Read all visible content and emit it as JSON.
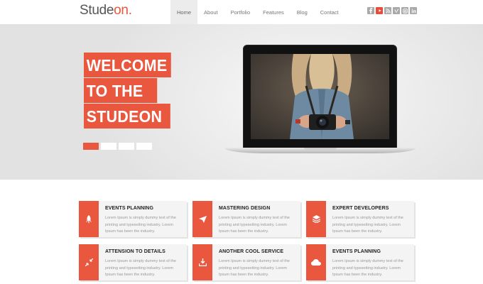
{
  "brand": {
    "logo_main": "Stude",
    "logo_accent": "on",
    "logo_dot": "."
  },
  "nav": {
    "items": [
      {
        "label": "Home",
        "active": true
      },
      {
        "label": "About",
        "active": false
      },
      {
        "label": "Portfolio",
        "active": false
      },
      {
        "label": "Features",
        "active": false
      },
      {
        "label": "Blog",
        "active": false
      },
      {
        "label": "Contact",
        "active": false
      }
    ]
  },
  "social": [
    "facebook-icon",
    "youtube-icon",
    "rss-icon",
    "vimeo-icon",
    "instagram-icon",
    "linkedin-icon"
  ],
  "hero": {
    "headline": [
      "WELCOME",
      "TO THE",
      "STUDEON"
    ],
    "slider_dots": 4,
    "active_dot": 0
  },
  "services": [
    {
      "title": "EVENTS PLANNING",
      "text": "Lorem Ipsum is simply dummy text of the printing and typesetting industry. Lorem Ipsum has been the industry.",
      "icon": "rocket-icon"
    },
    {
      "title": "MASTERING DESIGN",
      "text": "Lorem Ipsum is simply dummy text of the printing and typesetting industry. Lorem Ipsum has been the industry.",
      "icon": "paper-plane-icon"
    },
    {
      "title": "EXPERT DEVELOPERS",
      "text": "Lorem Ipsum is simply dummy text of the printing and typesetting industry. Lorem Ipsum has been the industry.",
      "icon": "layers-icon"
    },
    {
      "title": "ATTENSION TO DETAILS",
      "text": "Lorem Ipsum is simply dummy text of the printing and typesetting industry. Lorem Ipsum has been the industry.",
      "icon": "compress-icon"
    },
    {
      "title": "ANOTHER COOL SERVICE",
      "text": "Lorem Ipsum is simply dummy text of the printing and typesetting industry. Lorem Ipsum has been the industry.",
      "icon": "download-icon"
    },
    {
      "title": "EVENTS PLANNING",
      "text": "Lorem Ipsum is simply dummy text of the printing and typesetting industry. Lorem Ipsum has been the industry.",
      "icon": "cloud-icon"
    }
  ],
  "colors": {
    "accent": "#e9573f",
    "nav_active_bg": "#ececec",
    "social_grey": "#a9a9a9",
    "card_bg": "#f4f4f4"
  }
}
